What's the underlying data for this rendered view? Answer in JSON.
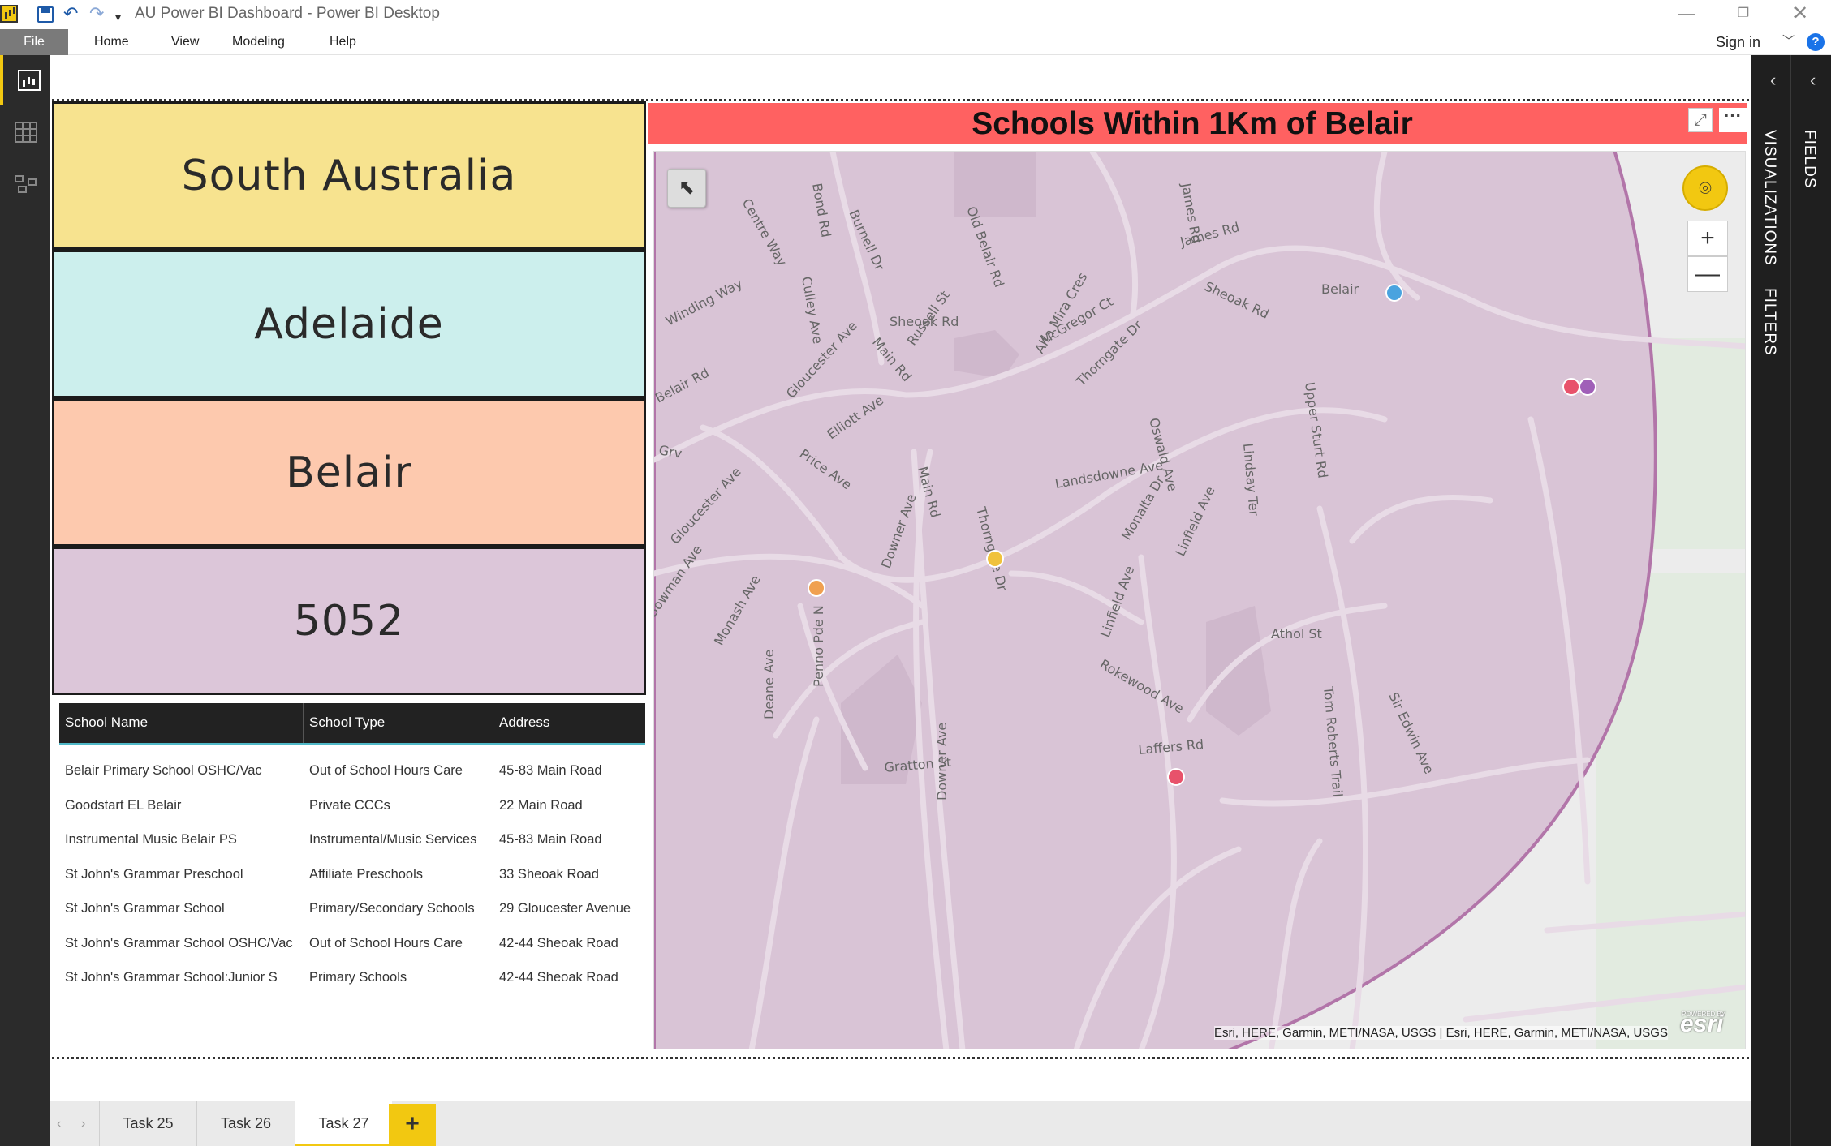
{
  "window": {
    "title": "AU Power BI Dashboard - Power BI Desktop"
  },
  "menu": {
    "file": "File",
    "items": [
      "Home",
      "View",
      "Modeling",
      "Help"
    ],
    "sign_in": "Sign in",
    "help_glyph": "?"
  },
  "cards": {
    "state": "South Australia",
    "city": "Adelaide",
    "suburb": "Belair",
    "postcode": "5052"
  },
  "colors": {
    "card_state": "#f7e38f",
    "card_city": "#ccefed",
    "card_suburb": "#fdc9ae",
    "card_postcode": "#dcc6d9",
    "map_header": "#ff6161",
    "accent": "#f2c811"
  },
  "table": {
    "columns": [
      "School Name",
      "School Type",
      "Address"
    ],
    "rows": [
      [
        "Belair Primary School OSHC/Vac",
        "Out of School Hours Care",
        "45-83 Main Road"
      ],
      [
        "Goodstart EL Belair",
        "Private CCCs",
        "22 Main Road"
      ],
      [
        "Instrumental Music Belair PS",
        "Instrumental/Music Services",
        "45-83 Main Road"
      ],
      [
        "St John's Grammar Preschool",
        "Affiliate Preschools",
        "33 Sheoak Road"
      ],
      [
        "St John's Grammar School",
        "Primary/Secondary Schools",
        "29 Gloucester Avenue"
      ],
      [
        "St John's Grammar School OSHC/Vac",
        "Out of School Hours Care",
        "42-44 Sheoak Road"
      ],
      [
        "St John's Grammar School:Junior S",
        "Primary Schools",
        "42-44 Sheoak Road"
      ]
    ]
  },
  "map": {
    "title": "Schools Within 1Km of Belair",
    "attribution": "Esri, HERE, Garmin, METI/NASA, USGS | Esri, HERE, Garmin, METI/NASA, USGS",
    "logo": "esri",
    "logo_powered": "POWERED BY",
    "street_labels": [
      "Centre Way",
      "Bond Rd",
      "Burnell Dr",
      "Old Belair Rd",
      "James Rd",
      "James Rd",
      "Culley Ave",
      "Sheoak Rd",
      "Belair",
      "Winding Way",
      "Sheoak Rd",
      "Main Rd",
      "Russell St",
      "Alta Mira Cres",
      "McGregor Ct",
      "Gloucester Ave",
      "Thorngate Dr",
      "Belair Rd",
      "Upper Sturt Rd",
      "Elliott Ave",
      "Grv",
      "Price Ave",
      "Oswald Ave",
      "Lindsay Ter",
      "Main Rd",
      "Landsdowne Ave",
      "Gloucester Ave",
      "Thorngate Dr",
      "Downer Ave",
      "Monalta Dr",
      "Linfield Ave",
      "Bowman Ave",
      "Monash Ave",
      "Athol St",
      "Linfield Ave",
      "Penno Pde N",
      "Deane Ave",
      "Rokewood Ave",
      "Sir Edwin Ave",
      "Tom Roberts Trail",
      "Laffers Rd",
      "Gratton St",
      "Downer Ave"
    ],
    "school_markers": [
      {
        "color": "#4aa3df"
      },
      {
        "color": "#e8526b"
      },
      {
        "color": "#a05fb8"
      },
      {
        "color": "#f0c23c"
      },
      {
        "color": "#f0a050"
      },
      {
        "color": "#e8526b"
      }
    ]
  },
  "tabs": {
    "items": [
      "Task 25",
      "Task 26",
      "Task 27"
    ],
    "active": "Task 27",
    "add_glyph": "+"
  },
  "rails": {
    "visualizations": "VISUALIZATIONS",
    "filters": "FILTERS",
    "fields": "FIELDS"
  }
}
